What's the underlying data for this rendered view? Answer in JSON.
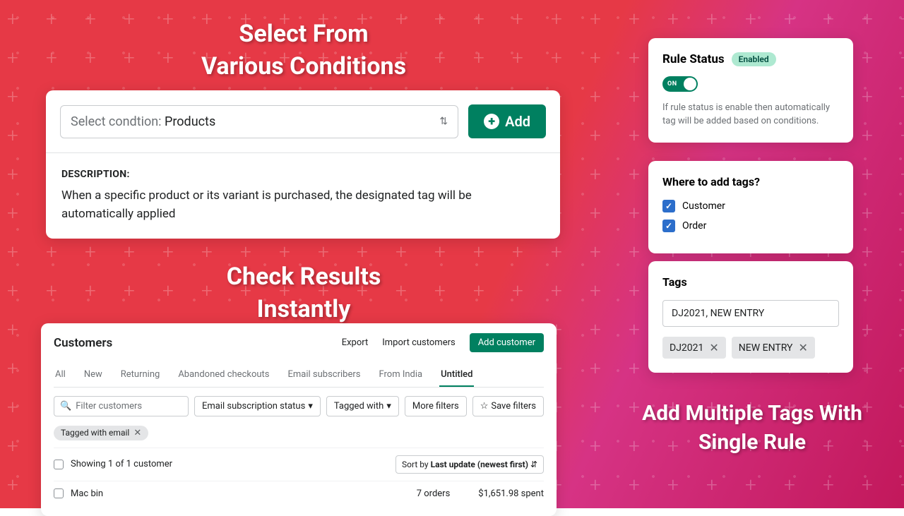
{
  "headings": {
    "h1": "Select From\nVarious Conditions",
    "h2": "Check Results\nInstantly",
    "h3": "Add Multiple Tags With\nSingle Rule"
  },
  "condition_panel": {
    "select_label": "Select condtion: ",
    "select_value": "Products",
    "add_label": "Add",
    "desc_heading": "DESCRIPTION:",
    "desc_text": "When a specific product or its variant is purchased, the designated tag will be automatically applied"
  },
  "customers_panel": {
    "title": "Customers",
    "export": "Export",
    "import": "Import customers",
    "add": "Add customer",
    "tabs": [
      "All",
      "New",
      "Returning",
      "Abandoned checkouts",
      "Email subscribers",
      "From India",
      "Untitled"
    ],
    "active_tab": "Untitled",
    "search_placeholder": "Filter customers",
    "filter_email": "Email subscription status",
    "filter_tagged": "Tagged with",
    "more_filters": "More filters",
    "save_filters": "Save filters",
    "applied_chip": "Tagged with email",
    "showing": "Showing 1 of 1 customer",
    "sort_label": "Sort by ",
    "sort_value": "Last update (newest first)",
    "customer_name": "Mac bin",
    "orders": "7 orders",
    "spent": "$1,651.98 spent"
  },
  "rule_status": {
    "title": "Rule Status",
    "badge": "Enabled",
    "toggle": "ON",
    "desc": "If rule status is enable then automatically tag will be added based on conditions."
  },
  "where_tags": {
    "title": "Where to add tags?",
    "options": [
      "Customer",
      "Order"
    ]
  },
  "tags_panel": {
    "title": "Tags",
    "input": "DJ2021, NEW ENTRY",
    "chips": [
      "DJ2021",
      "NEW ENTRY"
    ]
  }
}
